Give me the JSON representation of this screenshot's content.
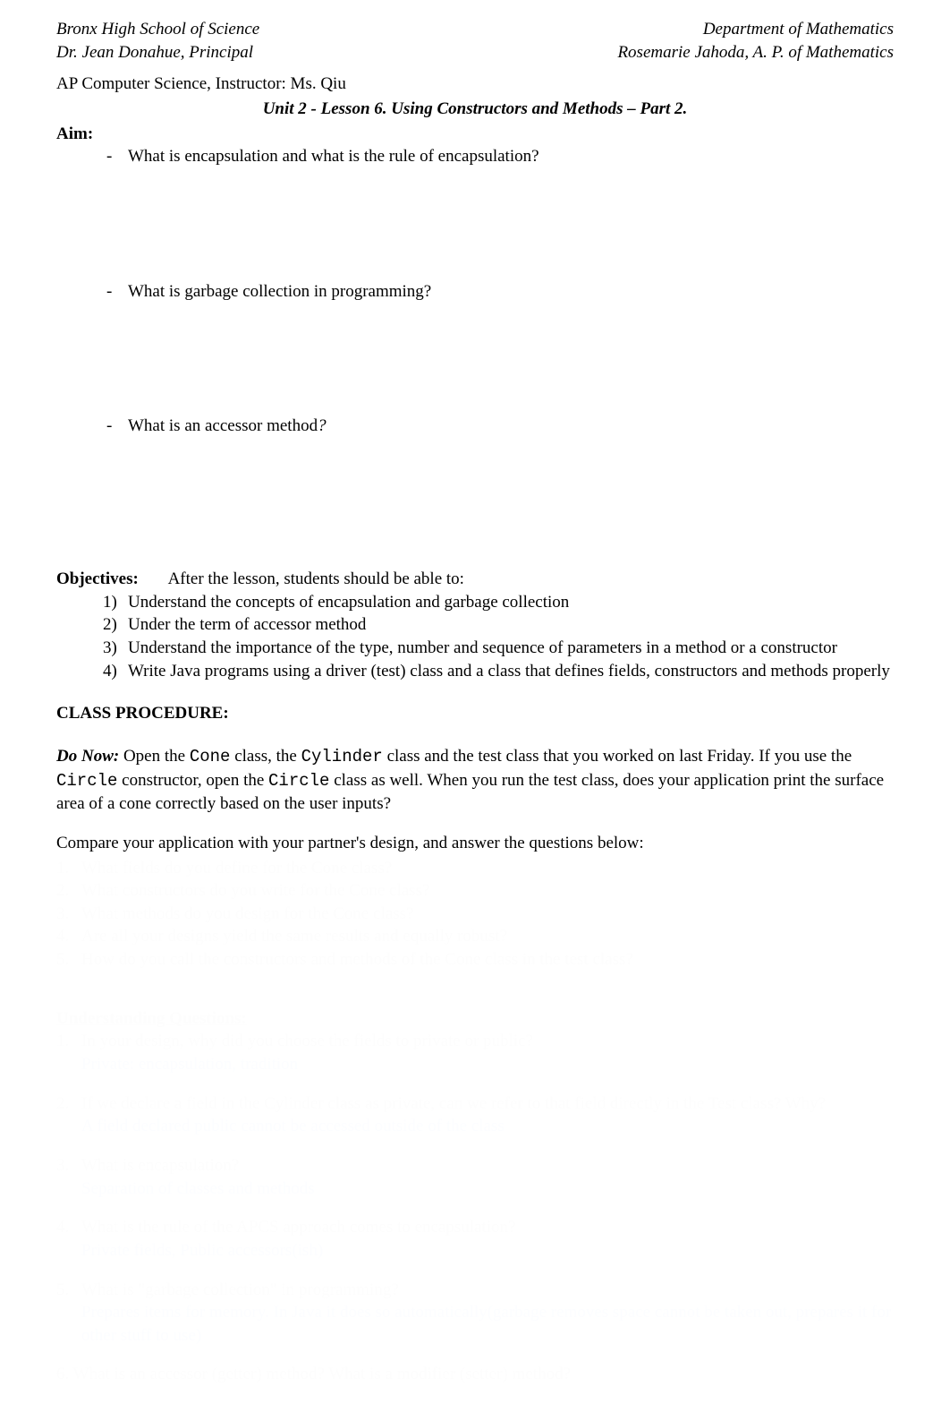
{
  "header": {
    "left1": "Bronx High School of Science",
    "right1": "Department of Mathematics",
    "left2": "Dr. Jean Donahue, Principal",
    "right2": "Rosemarie Jahoda, A. P. of Mathematics"
  },
  "instructor": "AP Computer Science, Instructor: Ms. Qiu",
  "title": "Unit 2 - Lesson 6. Using Constructors and Methods – Part 2.",
  "aim": {
    "label": "Aim:",
    "items": [
      "What is encapsulation and what is the rule of encapsulation?",
      "What is garbage collection in programming?",
      "What is an accessor method"
    ],
    "item3_suffix": "?"
  },
  "objectives": {
    "label": "Objectives:",
    "after": "After the lesson, students should be able to:",
    "items": [
      "Understand the concepts of encapsulation and garbage collection",
      "Under the term of accessor method",
      "Understand the importance of the type, number and sequence of parameters in a method or a constructor",
      "Write Java programs using a driver (test) class and a class that defines fields, constructors and methods properly"
    ]
  },
  "class_procedure": "CLASS PROCEDURE:",
  "donow": {
    "label": "Do Now:",
    "t1": " Open the ",
    "c1": "Cone",
    "t2": " class, the ",
    "c2": "Cylinder",
    "t3": " class and the test class that you worked on last Friday. If you use the ",
    "c3": "Circle",
    "t4": " constructor, open the ",
    "c4": "Circle",
    "t5": " class as well. When you run the test class, does your application print the surface area of a cone correctly based on the user inputs?"
  },
  "compare": "Compare your application with your partner's design, and answer the questions below:",
  "hidden_list1": [
    "What fields do you define for the Cone class?",
    "What constructors do you write for the Cone class?",
    "What methods do you design for the Cone class?",
    "Are all your designs yield the same results and equally robust?",
    "How do you call the constructors and methods of the Cone class in the test class?"
  ],
  "understanding_title": "Understanding Questions:",
  "uq": [
    {
      "q": "In your design, why did you choose the fields to private or public?",
      "a": "Private: encapsulation, tradition"
    },
    {
      "q": "If we declare a field in the Cylinder class as private, can we refer to that field directly in the Test class? Why?",
      "a": "A field declared public cannot be accessed outside of the class"
    },
    {
      "q": "What is encapsulation?",
      "a": "Separation of classes and methods"
    },
    {
      "q": "What is the rule of the APCS approach comes to encapsulation?",
      "a": "Private fields, Public accessors(ish)"
    },
    {
      "q": "What is \"garbage collection\" in programming?",
      "a": "Prepares items for memory. In Java it does so automatically(garbage removes space cannot be taken out, prepares it for other stuff to use)"
    }
  ],
  "uq6": "6. What is an accessor (getter) method? What is a modifier (setter) method?"
}
